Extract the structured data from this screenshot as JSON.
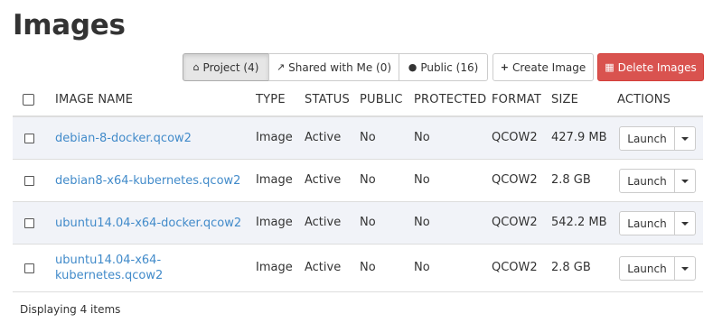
{
  "page": {
    "title": "Images"
  },
  "toolbar": {
    "project_label": "Project (4)",
    "shared_label": "Shared with Me (0)",
    "public_label": "Public (16)",
    "create_label": "Create Image",
    "delete_label": "Delete Images",
    "icons": {
      "project": "home-icon",
      "shared": "share-icon",
      "public": "users-icon",
      "create": "plus-icon",
      "delete": "trash-icon"
    },
    "colors": {
      "danger": "#d9534f",
      "active_filter_bg": "#e6e6e6"
    }
  },
  "table": {
    "columns": [
      "Image Name",
      "Type",
      "Status",
      "Public",
      "Protected",
      "Format",
      "Size",
      "Actions"
    ],
    "rows": [
      {
        "name": "debian-8-docker.qcow2",
        "type": "Image",
        "status": "Active",
        "public": "No",
        "protected": "No",
        "format": "QCOW2",
        "size": "427.9 MB",
        "action": "Launch"
      },
      {
        "name": "debian8-x64-kubernetes.qcow2",
        "type": "Image",
        "status": "Active",
        "public": "No",
        "protected": "No",
        "format": "QCOW2",
        "size": "2.8 GB",
        "action": "Launch"
      },
      {
        "name": "ubuntu14.04-x64-docker.qcow2",
        "type": "Image",
        "status": "Active",
        "public": "No",
        "protected": "No",
        "format": "QCOW2",
        "size": "542.2 MB",
        "action": "Launch"
      },
      {
        "name": "ubuntu14.04-x64-kubernetes.qcow2",
        "type": "Image",
        "status": "Active",
        "public": "No",
        "protected": "No",
        "format": "QCOW2",
        "size": "2.8 GB",
        "action": "Launch"
      }
    ],
    "link_color": "#428bca",
    "stripe_color": "#f1f3f8"
  },
  "footer": {
    "count_text": "Displaying 4 items"
  }
}
